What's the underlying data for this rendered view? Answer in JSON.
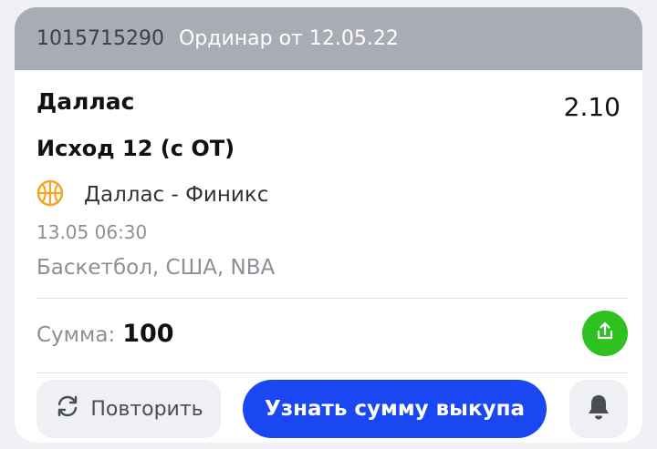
{
  "header": {
    "bet_id": "1015715290",
    "bet_type": "Ординар от 12.05.22"
  },
  "bet": {
    "team": "Даллас",
    "odds": "2.10",
    "outcome": "Исход 12 (с ОТ)",
    "event_name": "Даллас - Финикс",
    "event_icon": "basketball-icon",
    "datetime": "13.05 06:30",
    "league": "Баскетбол, США, NBA"
  },
  "sum": {
    "label": "Сумма:",
    "value": "100"
  },
  "actions": {
    "repeat_label": "Повторить",
    "cashout_label": "Узнать сумму выкупа",
    "share_icon": "share-icon",
    "bell_icon": "bell-icon"
  },
  "colors": {
    "header_bg": "#a9acb4",
    "primary_blue": "#1a47f2",
    "share_green": "#2ec11f",
    "basketball_orange": "#f5a623"
  }
}
